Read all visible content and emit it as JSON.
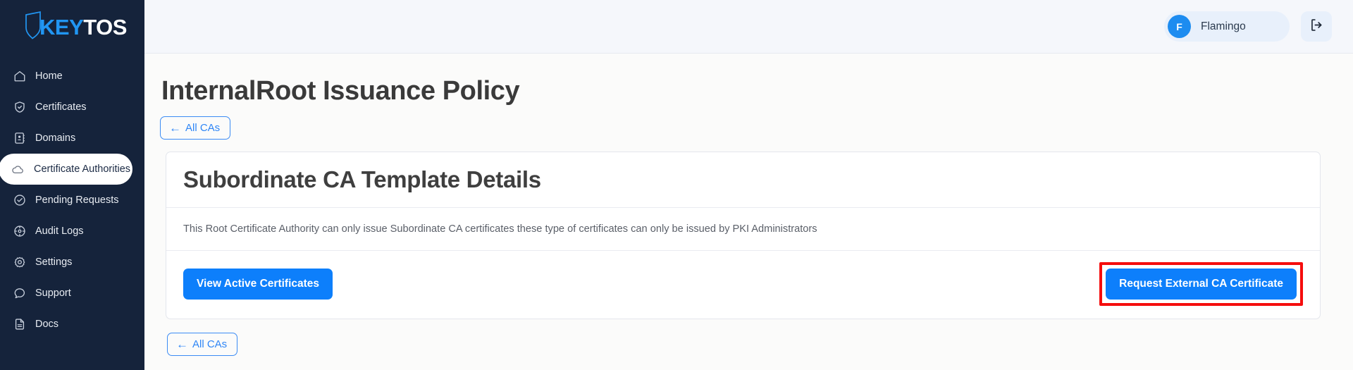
{
  "brand": {
    "logo_key": "KEY",
    "logo_tos": "TOS",
    "accent_blue": "#2196f3",
    "sidebar_bg": "#15233b"
  },
  "sidebar": {
    "items": [
      {
        "label": "Home",
        "icon": "home-icon",
        "active": false
      },
      {
        "label": "Certificates",
        "icon": "shield-check-icon",
        "active": false
      },
      {
        "label": "Domains",
        "icon": "address-book-icon",
        "active": false
      },
      {
        "label": "Certificate Authorities",
        "icon": "cloud-icon",
        "active": true
      },
      {
        "label": "Pending Requests",
        "icon": "check-circle-icon",
        "active": false
      },
      {
        "label": "Audit Logs",
        "icon": "compass-icon",
        "active": false
      },
      {
        "label": "Settings",
        "icon": "gear-icon",
        "active": false
      },
      {
        "label": "Support",
        "icon": "chat-bubble-icon",
        "active": false
      },
      {
        "label": "Docs",
        "icon": "document-icon",
        "active": false
      }
    ]
  },
  "topbar": {
    "user_initial": "F",
    "user_name": "Flamingo",
    "logout_icon": "logout-icon"
  },
  "page": {
    "title": "InternalRoot Issuance Policy",
    "back_button_label": "All CAs",
    "back_button_arrow": "←",
    "back_button_bottom_label": "All CAs"
  },
  "card": {
    "title": "Subordinate CA Template Details",
    "description": "This Root Certificate Authority can only issue Subordinate CA certificates these type of certificates can only be issued by PKI Administrators",
    "primary_button_label": "View Active Certificates",
    "secondary_button_label": "Request External CA Certificate"
  },
  "annotation": {
    "highlight_color": "#f50d0d",
    "target": "Request External CA Certificate"
  }
}
